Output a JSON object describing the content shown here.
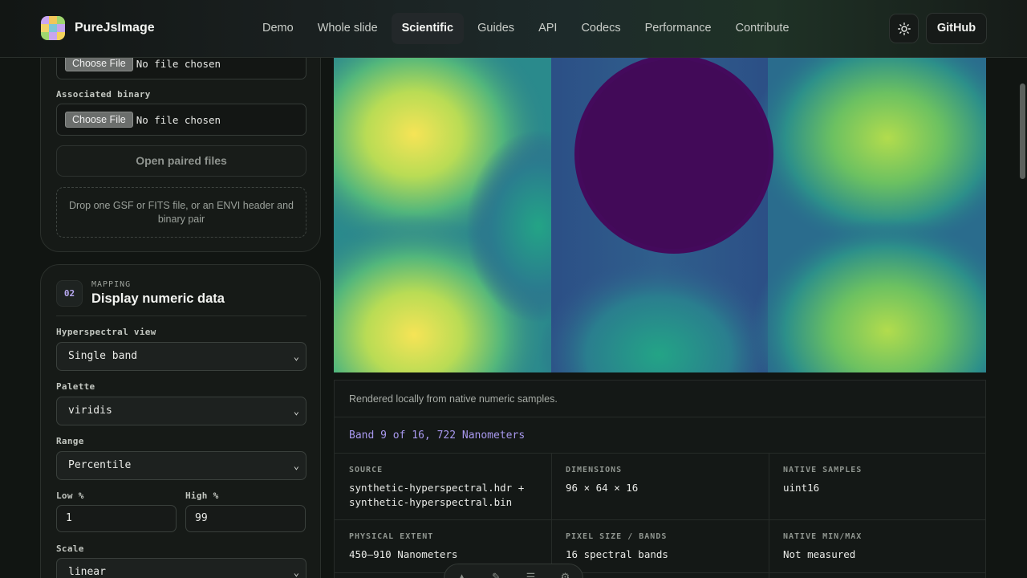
{
  "brand": {
    "name": "PureJsImage",
    "logo_icon": "logo-icon"
  },
  "nav": {
    "items": [
      {
        "label": "Demo"
      },
      {
        "label": "Whole slide"
      },
      {
        "label": "Scientific",
        "active": true
      },
      {
        "label": "Guides"
      },
      {
        "label": "API"
      },
      {
        "label": "Codecs"
      },
      {
        "label": "Performance"
      },
      {
        "label": "Contribute"
      }
    ]
  },
  "header": {
    "theme_icon": "sun-icon",
    "github_label": "GitHub"
  },
  "open_panel": {
    "primary_file": {
      "button": "Choose File",
      "status": "No file chosen"
    },
    "associated_label": "Associated binary",
    "associated_file": {
      "button": "Choose File",
      "status": "No file chosen"
    },
    "open_button": "Open paired files",
    "dropzone_text": "Drop one GSF or FITS file, or an ENVI header and binary pair"
  },
  "mapping_panel": {
    "step": "02",
    "kicker": "MAPPING",
    "title": "Display numeric data",
    "view_label": "Hyperspectral view",
    "view_value": "Single band",
    "palette_label": "Palette",
    "palette_value": "viridis",
    "range_label": "Range",
    "range_value": "Percentile",
    "low_label": "Low %",
    "low_value": "1",
    "high_label": "High %",
    "high_value": "99",
    "scale_label": "Scale",
    "scale_value": "linear"
  },
  "viewer": {
    "caption": "Rendered locally from native numeric samples.",
    "band": "Band 9 of 16, 722 Nanometers",
    "meta": [
      {
        "key": "SOURCE",
        "value": "synthetic-hyperspectral.hdr + synthetic-hyperspectral.bin"
      },
      {
        "key": "DIMENSIONS",
        "value": "96 × 64 × 16"
      },
      {
        "key": "NATIVE SAMPLES",
        "value": "uint16"
      },
      {
        "key": "PHYSICAL EXTENT",
        "value": "450–910 Nanometers"
      },
      {
        "key": "PIXEL SIZE / BANDS",
        "value": "16 spectral bands"
      },
      {
        "key": "NATIVE MIN/MAX",
        "value": "Not measured"
      }
    ]
  },
  "colors": {
    "accent_purple": "#a898ee",
    "viridis_low": "#440154",
    "viridis_mid": "#2a788e",
    "viridis_high": "#fde725"
  }
}
